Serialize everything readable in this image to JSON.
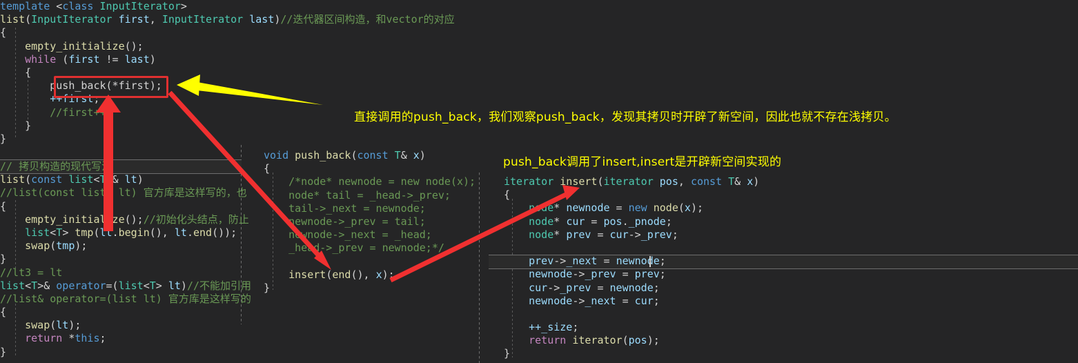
{
  "editor": {
    "background": "#252526",
    "highlight_color": "#2b2b2b",
    "annotation_color": "#ffff00",
    "arrow_color": "#f03030",
    "box_color": "#e03030"
  },
  "panes": {
    "top": {
      "name": "list-range-constructor",
      "lines": [
        [
          [
            "kw",
            "template "
          ],
          [
            "pln",
            "<"
          ],
          [
            "kw",
            "class "
          ],
          [
            "typ",
            "InputIterator"
          ],
          [
            "pln",
            ">"
          ]
        ],
        [
          [
            "fn",
            "list"
          ],
          [
            "pln",
            "("
          ],
          [
            "typ",
            "InputIterator"
          ],
          [
            "var",
            " first"
          ],
          [
            "pln",
            ", "
          ],
          [
            "typ",
            "InputIterator"
          ],
          [
            "var",
            " last"
          ],
          [
            "pln",
            ")"
          ],
          [
            "cmt",
            "//迭代器区间构造，和vector的对应"
          ]
        ],
        [
          [
            "pln",
            "{"
          ]
        ],
        [
          [
            "pln",
            "    "
          ],
          [
            "fn",
            "empty_initialize"
          ],
          [
            "pln",
            "();"
          ]
        ],
        [
          [
            "pln",
            "    "
          ],
          [
            "kwm",
            "while"
          ],
          [
            "pln",
            " ("
          ],
          [
            "var",
            "first"
          ],
          [
            "pln",
            " != "
          ],
          [
            "var",
            "last"
          ],
          [
            "pln",
            ")"
          ]
        ],
        [
          [
            "pln",
            "    {"
          ]
        ],
        [
          [
            "pln",
            "        "
          ],
          [
            "pln",
            "push_back(*first);"
          ]
        ],
        [
          [
            "pln",
            "        "
          ],
          [
            "var",
            "++first"
          ],
          [
            "pln",
            ";"
          ]
        ],
        [
          [
            "pln",
            "        "
          ],
          [
            "cmt",
            "//first++;"
          ]
        ],
        [
          [
            "pln",
            "    }"
          ]
        ],
        [
          [
            "pln",
            "}"
          ]
        ]
      ]
    },
    "left": {
      "name": "copy-constructor-and-assignment",
      "lines": [
        [
          [
            "cmt",
            "// 拷贝构造的现代写法"
          ]
        ],
        [
          [
            "fn",
            "list"
          ],
          [
            "pln",
            "("
          ],
          [
            "kw",
            "const "
          ],
          [
            "typ",
            "list"
          ],
          [
            "pln",
            "<"
          ],
          [
            "typ",
            "T"
          ],
          [
            "pln",
            ">& "
          ],
          [
            "var",
            "lt"
          ],
          [
            "pln",
            ")"
          ]
        ],
        [
          [
            "cmt",
            "//list(const list& lt) 官方库是这样写的，也"
          ]
        ],
        [
          [
            "pln",
            "{"
          ]
        ],
        [
          [
            "pln",
            "    "
          ],
          [
            "fn",
            "empty_initialize"
          ],
          [
            "pln",
            "();"
          ],
          [
            "cmt",
            "//初始化头结点，防止"
          ]
        ],
        [
          [
            "pln",
            "    "
          ],
          [
            "typ",
            "list"
          ],
          [
            "pln",
            "<"
          ],
          [
            "typ",
            "T"
          ],
          [
            "pln",
            "> "
          ],
          [
            "fn",
            "tmp"
          ],
          [
            "pln",
            "("
          ],
          [
            "var",
            "lt"
          ],
          [
            "pln",
            "."
          ],
          [
            "fn",
            "begin"
          ],
          [
            "pln",
            "(), "
          ],
          [
            "var",
            "lt"
          ],
          [
            "pln",
            "."
          ],
          [
            "fn",
            "end"
          ],
          [
            "pln",
            "());"
          ]
        ],
        [
          [
            "pln",
            "    "
          ],
          [
            "fn",
            "swap"
          ],
          [
            "pln",
            "("
          ],
          [
            "var",
            "tmp"
          ],
          [
            "pln",
            ");"
          ]
        ],
        [
          [
            "pln",
            "}"
          ]
        ],
        [
          [
            "cmt",
            "//lt3 = lt"
          ]
        ],
        [
          [
            "typ",
            "list"
          ],
          [
            "pln",
            "<"
          ],
          [
            "typ",
            "T"
          ],
          [
            "pln",
            ">& "
          ],
          [
            "kw",
            "operator"
          ],
          [
            "pln",
            "=("
          ],
          [
            "typ",
            "list"
          ],
          [
            "pln",
            "<"
          ],
          [
            "typ",
            "T"
          ],
          [
            "pln",
            "> "
          ],
          [
            "var",
            "lt"
          ],
          [
            "pln",
            ")"
          ],
          [
            "cmt",
            "//不能加引用"
          ]
        ],
        [
          [
            "cmt",
            "//list& operator=(list lt) 官方库是这样写的"
          ]
        ],
        [
          [
            "pln",
            "{"
          ]
        ],
        [
          [
            "pln",
            "    "
          ],
          [
            "fn",
            "swap"
          ],
          [
            "pln",
            "("
          ],
          [
            "var",
            "lt"
          ],
          [
            "pln",
            ");"
          ]
        ],
        [
          [
            "pln",
            "    "
          ],
          [
            "kwm",
            "return"
          ],
          [
            "pln",
            " *"
          ],
          [
            "kw",
            "this"
          ],
          [
            "pln",
            ";"
          ]
        ],
        [
          [
            "pln",
            "}"
          ]
        ]
      ]
    },
    "mid": {
      "name": "push-back-implementation",
      "lines": [
        [
          [
            "kw",
            "void "
          ],
          [
            "fn",
            "push_back"
          ],
          [
            "pln",
            "("
          ],
          [
            "kw",
            "const "
          ],
          [
            "typ",
            "T"
          ],
          [
            "pln",
            "& "
          ],
          [
            "var",
            "x"
          ],
          [
            "pln",
            ")"
          ]
        ],
        [
          [
            "pln",
            "{"
          ]
        ],
        [
          [
            "cmt",
            "    /*node* newnode = new node(x);"
          ]
        ],
        [
          [
            "cmt",
            "    node* tail = _head->_prev;"
          ]
        ],
        [
          [
            "cmt",
            "    tail->_next = newnode;"
          ]
        ],
        [
          [
            "cmt",
            "    newnode->_prev = tail;"
          ]
        ],
        [
          [
            "cmt",
            "    newnode->_next = _head;"
          ]
        ],
        [
          [
            "cmt",
            "    _head->_prev = newnode;*/"
          ]
        ],
        [
          [
            "pln",
            ""
          ]
        ],
        [
          [
            "pln",
            "    "
          ],
          [
            "fn",
            "insert"
          ],
          [
            "pln",
            "("
          ],
          [
            "fn",
            "end"
          ],
          [
            "pln",
            "(), "
          ],
          [
            "var",
            "x"
          ],
          [
            "pln",
            ");"
          ]
        ],
        [
          [
            "pln",
            "}"
          ]
        ]
      ]
    },
    "right": {
      "name": "insert-implementation",
      "lines": [
        [
          [
            "typ",
            "iterator "
          ],
          [
            "fn",
            "insert"
          ],
          [
            "pln",
            "("
          ],
          [
            "typ",
            "iterator"
          ],
          [
            "var",
            " pos"
          ],
          [
            "pln",
            ", "
          ],
          [
            "kw",
            "const "
          ],
          [
            "typ",
            "T"
          ],
          [
            "pln",
            "& "
          ],
          [
            "var",
            "x"
          ],
          [
            "pln",
            ")"
          ]
        ],
        [
          [
            "pln",
            "{"
          ]
        ],
        [
          [
            "typ",
            "    node"
          ],
          [
            "pln",
            "* "
          ],
          [
            "var",
            "newnode"
          ],
          [
            "pln",
            " = "
          ],
          [
            "kw",
            "new "
          ],
          [
            "fn",
            "node"
          ],
          [
            "pln",
            "("
          ],
          [
            "var",
            "x"
          ],
          [
            "pln",
            ");"
          ]
        ],
        [
          [
            "typ",
            "    node"
          ],
          [
            "pln",
            "* "
          ],
          [
            "var",
            "cur"
          ],
          [
            "pln",
            " = "
          ],
          [
            "var",
            "pos"
          ],
          [
            "pln",
            "."
          ],
          [
            "var",
            "_pnode"
          ],
          [
            "pln",
            ";"
          ]
        ],
        [
          [
            "typ",
            "    node"
          ],
          [
            "pln",
            "* "
          ],
          [
            "var",
            "prev"
          ],
          [
            "pln",
            " = "
          ],
          [
            "var",
            "cur"
          ],
          [
            "pln",
            "->"
          ],
          [
            "var",
            "_prev"
          ],
          [
            "pln",
            ";"
          ]
        ],
        [
          [
            "pln",
            ""
          ]
        ],
        [
          [
            "pln",
            "    "
          ],
          [
            "var",
            "prev"
          ],
          [
            "pln",
            "->"
          ],
          [
            "var",
            "_next"
          ],
          [
            "pln",
            " = "
          ],
          [
            "var",
            "newnode"
          ],
          [
            "pln",
            ";"
          ]
        ],
        [
          [
            "pln",
            "    "
          ],
          [
            "var",
            "newnode"
          ],
          [
            "pln",
            "->"
          ],
          [
            "var",
            "_prev"
          ],
          [
            "pln",
            " = "
          ],
          [
            "var",
            "prev"
          ],
          [
            "pln",
            ";"
          ]
        ],
        [
          [
            "pln",
            "    "
          ],
          [
            "var",
            "cur"
          ],
          [
            "pln",
            "->"
          ],
          [
            "var",
            "_prev"
          ],
          [
            "pln",
            " = "
          ],
          [
            "var",
            "newnode"
          ],
          [
            "pln",
            ";"
          ]
        ],
        [
          [
            "pln",
            "    "
          ],
          [
            "var",
            "newnode"
          ],
          [
            "pln",
            "->"
          ],
          [
            "var",
            "_next"
          ],
          [
            "pln",
            " = "
          ],
          [
            "var",
            "cur"
          ],
          [
            "pln",
            ";"
          ]
        ],
        [
          [
            "pln",
            ""
          ]
        ],
        [
          [
            "pln",
            "    "
          ],
          [
            "var",
            "++_size"
          ],
          [
            "pln",
            ";"
          ]
        ],
        [
          [
            "pln",
            "    "
          ],
          [
            "kwm",
            "return "
          ],
          [
            "fn",
            "iterator"
          ],
          [
            "pln",
            "("
          ],
          [
            "var",
            "pos"
          ],
          [
            "pln",
            ");"
          ]
        ],
        [
          [
            "pln",
            "}"
          ]
        ]
      ]
    }
  },
  "annotations": {
    "note1": "直接调用的push_back，我们观察push_back，发现其拷贝时开辟了新空间，因此也就不存在浅拷贝。",
    "note2": "push_back调用了insert,insert是开辟新空间实现的",
    "highlight_box_target": "push_back(*first);",
    "arrows": [
      {
        "name": "yellow-arrow-to-push-back-call",
        "color": "#ffff00"
      },
      {
        "name": "red-arrow-up-to-push-back-call",
        "color": "#f03030"
      },
      {
        "name": "red-arrow-push-back-call-to-insert-call",
        "color": "#f03030"
      },
      {
        "name": "red-arrow-insert-call-to-insert-definition",
        "color": "#f03030"
      }
    ]
  }
}
